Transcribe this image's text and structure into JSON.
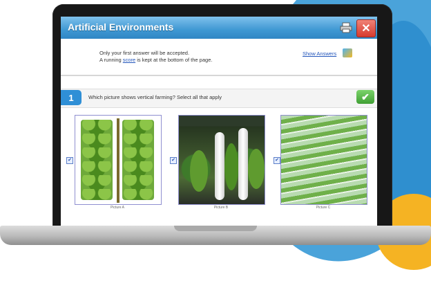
{
  "window": {
    "title": "Artificial Environments",
    "print_icon": "printer-icon",
    "close_icon": "close-icon"
  },
  "instructions": {
    "line1": "Only your first answer will be accepted.",
    "line2_prefix": "A running ",
    "line2_link": "score",
    "line2_suffix": " is kept at the bottom of the page."
  },
  "show_answers": {
    "label": "Show Answers",
    "icon": "answers-icon"
  },
  "question": {
    "number": "1",
    "text": "Which picture shows vertical farming? Select all that apply",
    "submit_icon": "checkmark-icon",
    "options": [
      {
        "caption": "Picture A",
        "checked": true,
        "image": "stacked-lettuce-image"
      },
      {
        "caption": "Picture B",
        "checked": true,
        "image": "greenhouse-towers-image"
      },
      {
        "caption": "Picture C",
        "checked": true,
        "image": "hanging-lettuce-image"
      }
    ]
  },
  "colors": {
    "header_blue": "#3f98d3",
    "close_red": "#d63a2f",
    "check_green": "#3f9f34",
    "link_blue": "#2255bb"
  }
}
